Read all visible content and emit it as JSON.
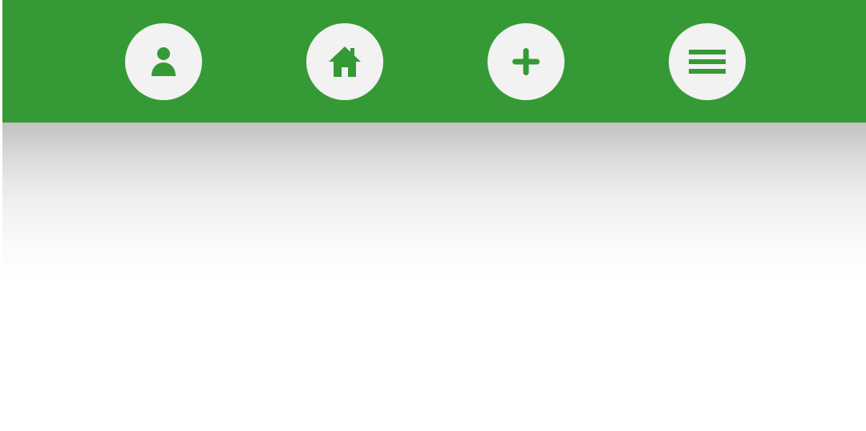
{
  "colors": {
    "nav_background": "#359a35",
    "button_background": "#f2f2f2",
    "icon_color": "#359a35",
    "page_background": "#ffffff"
  },
  "nav": {
    "buttons": [
      {
        "icon": "person-icon"
      },
      {
        "icon": "home-icon"
      },
      {
        "icon": "plus-icon"
      },
      {
        "icon": "hamburger-menu-icon"
      }
    ]
  }
}
